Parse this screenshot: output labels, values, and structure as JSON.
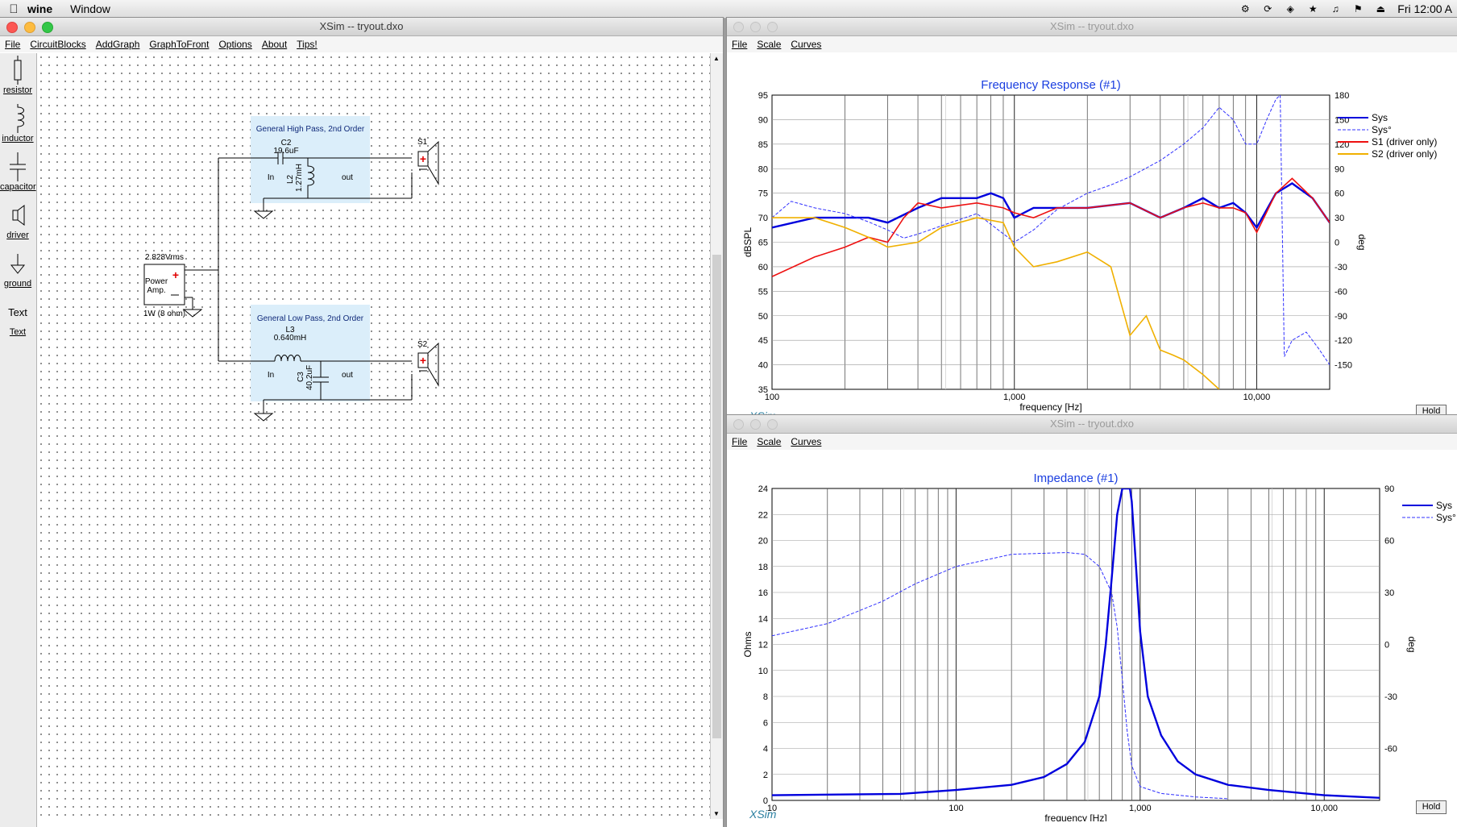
{
  "menubar": {
    "app_name": "wine",
    "window_menu": "Window",
    "clock": "Fri 12:00 A"
  },
  "editor": {
    "title": "XSim -- tryout.dxo",
    "menu": [
      "File",
      "CircuitBlocks",
      "AddGraph",
      "GraphToFront",
      "Options",
      "About",
      "Tips!"
    ],
    "tools": [
      {
        "label": "resistor",
        "icon": "resistor-icon"
      },
      {
        "label": "inductor",
        "icon": "inductor-icon"
      },
      {
        "label": "capacitor",
        "icon": "capacitor-icon"
      },
      {
        "label": "driver",
        "icon": "driver-icon"
      },
      {
        "label": "ground",
        "icon": "ground-icon"
      },
      {
        "label": "Text",
        "icon": "text-icon",
        "glyph": "Text"
      }
    ]
  },
  "schematic": {
    "amp": {
      "voltage": "2.828Vrms",
      "name_line1": "Power",
      "name_line2": "Amp.",
      "power": "1W (8 ohm)"
    },
    "hp": {
      "title": "General High Pass, 2nd Order",
      "c_name": "C2",
      "c_value": "19.6uF",
      "l_name": "L2",
      "l_value": "1.27mH",
      "in": "In",
      "out": "out",
      "driver": "S1"
    },
    "lp": {
      "title": "General Low Pass, 2nd Order",
      "l_name": "L3",
      "l_value": "0.640mH",
      "c_name": "C3",
      "c_value": "40.2uF",
      "in": "In",
      "out": "out",
      "driver": "S2"
    }
  },
  "freq_window": {
    "title": "XSim -- tryout.dxo",
    "menu": [
      "File",
      "Scale",
      "Curves"
    ],
    "hold": "Hold",
    "xsim": "XSim",
    "chart_data": {
      "type": "line",
      "title": "Frequency Response (#1)",
      "xlabel": "frequency [Hz]",
      "ylabel": "dBSPL",
      "y2label": "deg",
      "xscale": "log",
      "xlim": [
        100,
        20000
      ],
      "ylim": [
        35,
        95
      ],
      "y2lim": [
        -180,
        180
      ],
      "xticks": [
        "100",
        "1,000",
        "10,000"
      ],
      "yticks": [
        "95",
        "90",
        "85",
        "80",
        "75",
        "70",
        "65",
        "60",
        "55",
        "50",
        "45",
        "40",
        "35"
      ],
      "y2ticks": [
        "180",
        "150",
        "120",
        "90",
        "60",
        "30",
        "0",
        "-30",
        "-60",
        "-90",
        "-120",
        "-150"
      ],
      "legend": [
        "Sys",
        "Sys°",
        "S1 (driver only)",
        "S2 (driver only)"
      ],
      "grid": true,
      "series": [
        {
          "name": "Sys",
          "color": "#0000dd",
          "axis": "left",
          "x": [
            100,
            150,
            200,
            250,
            300,
            400,
            500,
            700,
            800,
            900,
            1000,
            1200,
            1500,
            2000,
            3000,
            4000,
            5000,
            6000,
            7000,
            8000,
            9000,
            10000,
            12000,
            14000,
            17000,
            20000
          ],
          "y": [
            68,
            70,
            70,
            70,
            69,
            72,
            74,
            74,
            75,
            74,
            70,
            72,
            72,
            72,
            73,
            70,
            72,
            74,
            72,
            73,
            71,
            68,
            75,
            77,
            74,
            69
          ]
        },
        {
          "name": "Sys°",
          "color": "#3030ff",
          "axis": "right",
          "x": [
            100,
            120,
            150,
            200,
            250,
            300,
            350,
            400,
            500,
            700,
            1000,
            1200,
            1500,
            2000,
            2500,
            3000,
            4000,
            5000,
            6000,
            7000,
            8000,
            9000,
            10000,
            11000,
            12000,
            12500,
            13000,
            14000,
            16000,
            18000,
            20000
          ],
          "y": [
            30,
            50,
            42,
            35,
            25,
            15,
            5,
            10,
            20,
            35,
            0,
            15,
            40,
            60,
            70,
            80,
            100,
            120,
            140,
            165,
            150,
            120,
            120,
            150,
            175,
            180,
            -140,
            -120,
            -110,
            -130,
            -150
          ]
        },
        {
          "name": "S1 (driver only)",
          "color": "#ee1111",
          "axis": "left",
          "x": [
            100,
            150,
            200,
            250,
            300,
            350,
            400,
            500,
            700,
            900,
            1000,
            1200,
            1500,
            2000,
            3000,
            4000,
            5000,
            6000,
            7000,
            8000,
            9000,
            10000,
            12000,
            14000,
            17000,
            20000
          ],
          "y": [
            58,
            62,
            64,
            66,
            65,
            70,
            73,
            72,
            73,
            72,
            71,
            70,
            72,
            72,
            73,
            70,
            72,
            73,
            72,
            72,
            71,
            67,
            75,
            78,
            74,
            69
          ]
        },
        {
          "name": "S2 (driver only)",
          "color": "#f0b000",
          "axis": "left",
          "x": [
            100,
            150,
            200,
            250,
            300,
            400,
            500,
            700,
            900,
            1000,
            1200,
            1500,
            2000,
            2500,
            3000,
            3500,
            4000,
            4500,
            5000,
            6000,
            7000
          ],
          "y": [
            70,
            70,
            68,
            66,
            64,
            65,
            68,
            70,
            69,
            64,
            60,
            61,
            63,
            60,
            46,
            50,
            43,
            42,
            41,
            38,
            35
          ]
        }
      ]
    }
  },
  "imp_window": {
    "title": "XSim -- tryout.dxo",
    "menu": [
      "File",
      "Scale",
      "Curves"
    ],
    "hold": "Hold",
    "xsim": "XSim",
    "chart_data": {
      "type": "line",
      "title": "Impedance (#1)",
      "xlabel": "frequency [Hz]",
      "ylabel": "Ohms",
      "y2label": "deg",
      "xscale": "log",
      "xlim": [
        10,
        20000
      ],
      "ylim": [
        0,
        24
      ],
      "y2lim": [
        -90,
        90
      ],
      "xticks": [
        "10",
        "100",
        "1,000",
        "10,000"
      ],
      "yticks": [
        "24",
        "22",
        "20",
        "18",
        "16",
        "14",
        "12",
        "10",
        "8",
        "6",
        "4",
        "2",
        "0"
      ],
      "y2ticks": [
        "90",
        "60",
        "30",
        "0",
        "-30",
        "-60"
      ],
      "legend": [
        "Sys",
        "Sys°"
      ],
      "grid": true,
      "series": [
        {
          "name": "Sys",
          "color": "#0000dd",
          "axis": "left",
          "x": [
            10,
            50,
            100,
            200,
            300,
            400,
            500,
            600,
            650,
            700,
            750,
            800,
            850,
            880,
            900,
            950,
            1000,
            1100,
            1300,
            1600,
            2000,
            3000,
            5000,
            10000,
            20000
          ],
          "y": [
            0.4,
            0.5,
            0.8,
            1.2,
            1.8,
            2.8,
            4.5,
            8,
            12,
            17,
            22,
            24,
            24,
            24,
            23,
            18,
            13,
            8,
            5,
            3,
            2,
            1.2,
            0.8,
            0.4,
            0.2
          ]
        },
        {
          "name": "Sys°",
          "color": "#3030ff",
          "axis": "right",
          "x": [
            10,
            20,
            40,
            60,
            100,
            200,
            400,
            500,
            600,
            700,
            750,
            800,
            850,
            900,
            1000,
            1300,
            2000,
            3000
          ],
          "y": [
            5,
            12,
            25,
            35,
            45,
            52,
            53,
            52,
            45,
            30,
            10,
            -20,
            -50,
            -70,
            -82,
            -86,
            -88,
            -89
          ]
        }
      ]
    }
  }
}
